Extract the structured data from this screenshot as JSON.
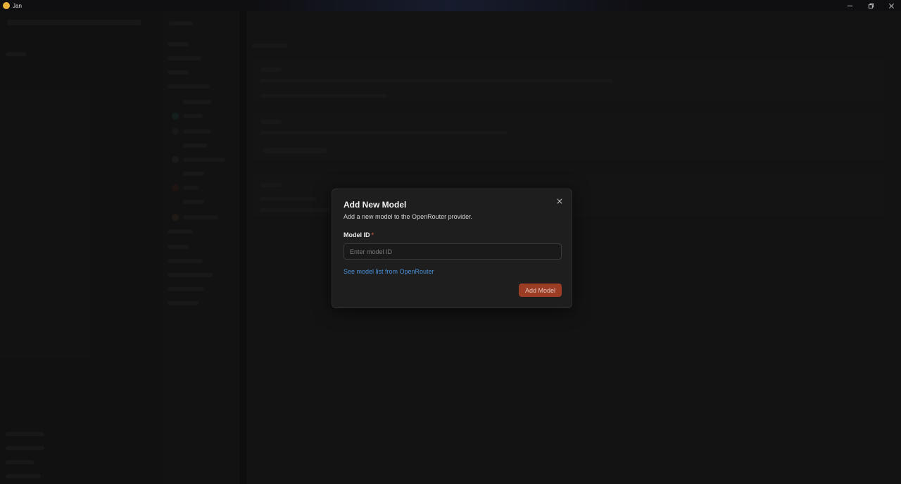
{
  "window": {
    "title": "Jan",
    "logo_icon": "jan-logo-icon",
    "controls": [
      "minimize-icon",
      "restore-icon",
      "close-icon"
    ]
  },
  "dialog": {
    "title": "Add New Model",
    "subtitle": "Add a new model to the OpenRouter provider.",
    "field_label": "Model ID",
    "required_mark": "*",
    "input_value": "",
    "input_placeholder": "Enter model ID",
    "link_text": "See model list from OpenRouter",
    "submit_label": "Add Model",
    "close_icon": "close-icon"
  },
  "colors": {
    "accent": "#9b3d25",
    "link": "#4a90d9",
    "dialog_bg": "#1e1e1e",
    "page_bg": "#161616"
  }
}
